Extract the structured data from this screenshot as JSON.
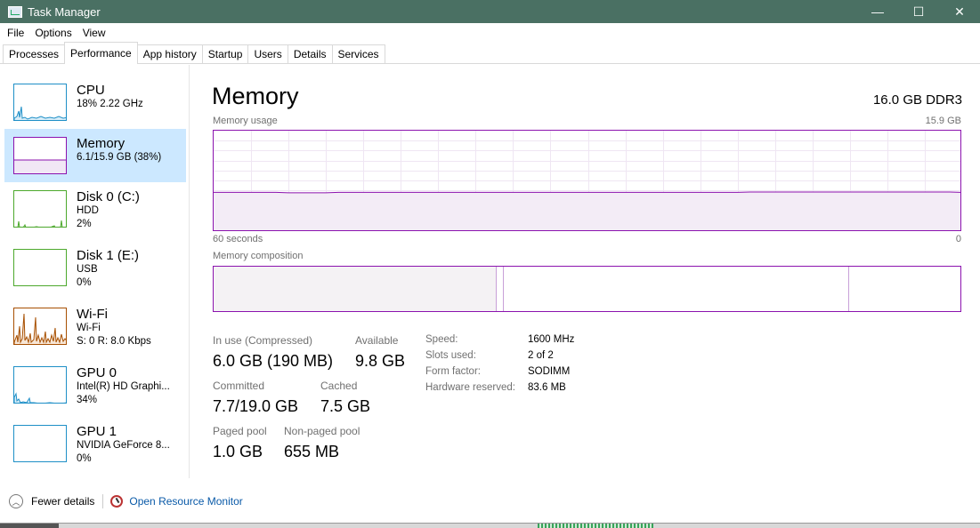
{
  "window": {
    "title": "Task Manager",
    "controls": {
      "minimize": "—",
      "maximize": "☐",
      "close": "✕"
    }
  },
  "menu": [
    "File",
    "Options",
    "View"
  ],
  "tabs": [
    "Processes",
    "Performance",
    "App history",
    "Startup",
    "Users",
    "Details",
    "Services"
  ],
  "active_tab": "Performance",
  "sidebar": [
    {
      "name": "CPU",
      "line1": "18%  2.22 GHz",
      "line2": "",
      "color": "#1e8fc7"
    },
    {
      "name": "Memory",
      "line1": "6.1/15.9 GB (38%)",
      "line2": "",
      "color": "#8b12ae",
      "selected": true
    },
    {
      "name": "Disk 0 (C:)",
      "line1": "HDD",
      "line2": "2%",
      "color": "#4ca82c"
    },
    {
      "name": "Disk 1 (E:)",
      "line1": "USB",
      "line2": "0%",
      "color": "#4ca82c"
    },
    {
      "name": "Wi-Fi",
      "line1": "Wi-Fi",
      "line2": "S: 0  R: 8.0 Kbps",
      "color": "#a74f01"
    },
    {
      "name": "GPU 0",
      "line1": "Intel(R) HD Graphi...",
      "line2": "34%",
      "color": "#1e8fc7"
    },
    {
      "name": "GPU 1",
      "line1": "NVIDIA GeForce 8...",
      "line2": "0%",
      "color": "#1e8fc7"
    }
  ],
  "memory": {
    "title": "Memory",
    "spec": "16.0 GB DDR3",
    "usage_label": "Memory usage",
    "usage_max": "15.9 GB",
    "time_left": "60 seconds",
    "time_right": "0",
    "composition_label": "Memory composition",
    "usage_fraction": 0.38,
    "stats": {
      "in_use_label": "In use (Compressed)",
      "in_use_value": "6.0 GB (190 MB)",
      "available_label": "Available",
      "available_value": "9.8 GB",
      "committed_label": "Committed",
      "committed_value": "7.7/19.0 GB",
      "cached_label": "Cached",
      "cached_value": "7.5 GB",
      "paged_label": "Paged pool",
      "paged_value": "1.0 GB",
      "nonpaged_label": "Non-paged pool",
      "nonpaged_value": "655 MB"
    },
    "details": [
      {
        "label": "Speed:",
        "value": "1600 MHz"
      },
      {
        "label": "Slots used:",
        "value": "2 of 2"
      },
      {
        "label": "Form factor:",
        "value": "SODIMM"
      },
      {
        "label": "Hardware reserved:",
        "value": "83.6 MB"
      }
    ]
  },
  "footer": {
    "fewer_details": "Fewer details",
    "resource_monitor": "Open Resource Monitor"
  }
}
